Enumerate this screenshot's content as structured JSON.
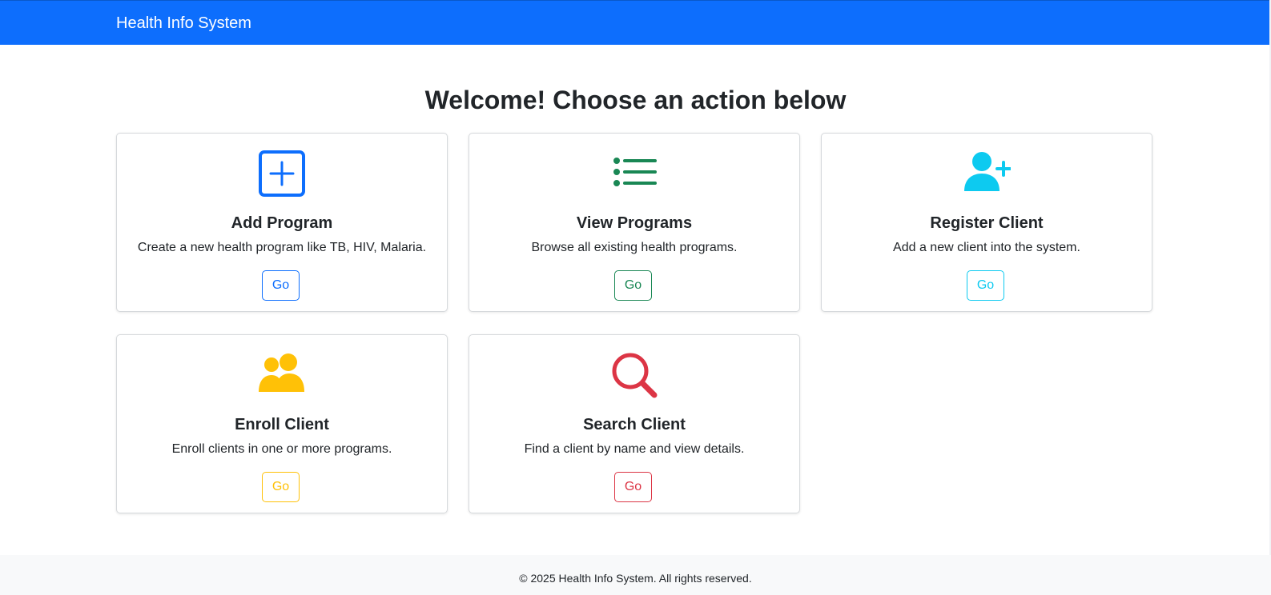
{
  "navbar": {
    "brand": "Health Info System",
    "color": "#0d6efd"
  },
  "main": {
    "heading": "Welcome! Choose an action below",
    "cards": [
      {
        "title": "Add Program",
        "description": "Create a new health program like TB, HIV, Malaria.",
        "button_label": "Go",
        "icon": "plus-square-icon",
        "color": "#0d6efd"
      },
      {
        "title": "View Programs",
        "description": "Browse all existing health programs.",
        "button_label": "Go",
        "icon": "list-icon",
        "color": "#198754"
      },
      {
        "title": "Register Client",
        "description": "Add a new client into the system.",
        "button_label": "Go",
        "icon": "person-plus-icon",
        "color": "#0dcaf0"
      },
      {
        "title": "Enroll Client",
        "description": "Enroll clients in one or more programs.",
        "button_label": "Go",
        "icon": "people-icon",
        "color": "#ffc107"
      },
      {
        "title": "Search Client",
        "description": "Find a client by name and view details.",
        "button_label": "Go",
        "icon": "search-icon",
        "color": "#dc3545"
      }
    ]
  },
  "footer": {
    "text": "© 2025 Health Info System. All rights reserved."
  }
}
